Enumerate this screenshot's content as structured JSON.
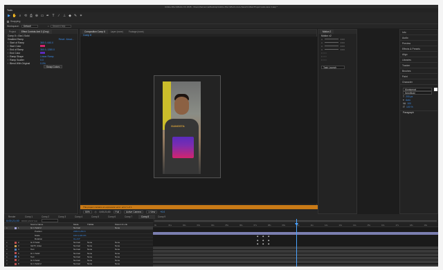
{
  "window": {
    "title": "Adobe After Effects CC 2018 - /Users/Aarvenma/Desktop/Adobe After Effects Auto-Save/Untitled Project auto-save 1.aep *"
  },
  "menubar": {
    "label": "Tools"
  },
  "toolbar": {
    "tools": [
      {
        "icon": "selection-icon",
        "glyph": "▶",
        "active": true
      },
      {
        "icon": "hand-icon",
        "glyph": "✋"
      },
      {
        "icon": "zoom-icon",
        "glyph": "⌕"
      },
      {
        "icon": "rotate-icon",
        "glyph": "⟲"
      },
      {
        "icon": "camera-icon",
        "glyph": "⎙"
      },
      {
        "icon": "pan-behind-icon",
        "glyph": "⊕"
      },
      {
        "icon": "mask-icon",
        "glyph": "▭"
      },
      {
        "icon": "pen-icon",
        "glyph": "✒"
      },
      {
        "icon": "type-icon",
        "glyph": "T"
      },
      {
        "icon": "brush-icon",
        "glyph": "∕"
      },
      {
        "icon": "stamp-icon",
        "glyph": "⊥"
      },
      {
        "icon": "eraser-icon",
        "glyph": "◆"
      },
      {
        "icon": "roto-icon",
        "glyph": "✎"
      },
      {
        "icon": "puppet-icon",
        "glyph": "✶"
      }
    ]
  },
  "snapping": {
    "label": "Snapping"
  },
  "workspace": {
    "label": "Workspace:",
    "value": "Default",
    "search_placeholder": "Search Help"
  },
  "left_panel": {
    "tabs": [
      "Project",
      "Effect Controls Amt 3 (Cmp)"
    ],
    "comp_path": "Comp 8 • Gkn1 Solid",
    "effect_name": "Gradient Ramp",
    "effect_header": {
      "reset": "Reset",
      "about": "About..."
    },
    "rows": [
      {
        "label": "Start of Ramp",
        "value": "360.0, 640.0"
      },
      {
        "label": "Start Color",
        "value": ""
      },
      {
        "label": "End of Ramp",
        "value": "360.0, 1280.0"
      },
      {
        "label": "End Color",
        "value": ""
      },
      {
        "label": "Ramp Shape",
        "value": "Linear Ramp"
      },
      {
        "label": "Ramp Scatter",
        "value": "0.0"
      },
      {
        "label": "Blend With Original",
        "value": "0.0%"
      }
    ],
    "swap_button": "Swap Colors"
  },
  "comp_panel": {
    "tabs": [
      "Composition Comp 8",
      "Layer (none)",
      "Footage (none)"
    ],
    "comp_label": "Comp 8",
    "photo_text": "GANGSTA",
    "warning": "This project contains an expression error: error 1 of 1",
    "zoom": "50%",
    "timecode": "0;00;21;00",
    "quality": "Full",
    "camera": "Active Camera",
    "views": "1 View",
    "offset": "+0.0"
  },
  "align_panel": {
    "title": "Motion 2",
    "sub": "Motion v2",
    "launch_button": "Task Launch"
  },
  "right_panel": {
    "items": [
      "Info",
      "Audio",
      "Preview",
      "Effects & Presets",
      "Align",
      "Libraries",
      "Tracker",
      "Brushes",
      "Paint",
      "Character"
    ],
    "character": {
      "font": "Montserrat",
      "style": "SemiBold",
      "size": "200 px",
      "leading": "Auto",
      "tracking": "100",
      "scale": "100 %",
      "paragraph": "Paragraph"
    }
  },
  "comp_tabs": [
    "Render Queue",
    "Comp 1",
    "Comp 2",
    "Comp 3",
    "Comp 4",
    "Comp 5",
    "Comp 6",
    "Comp 7",
    "Comp 8",
    "Comp 9"
  ],
  "timeline": {
    "timecode": "0;00;21;00",
    "fps": "00630 (29.97 fps)",
    "headers": {
      "name": "Source Name",
      "mode": "Mode",
      "trk": "TrkMat",
      "parent": "Parent & Link"
    },
    "layers": [
      {
        "num": "1",
        "name": "Gr 1 Solid 2",
        "mode": "Normal",
        "trk": "",
        "parent": "None",
        "color": "#a4a4dc",
        "selected": true
      },
      {
        "num": "",
        "name": "Position",
        "mode": "",
        "trk": "",
        "parent": "",
        "color": "",
        "value": "2382.6,250.6"
      },
      {
        "num": "",
        "name": "Scale",
        "mode": "",
        "trk": "",
        "parent": "",
        "color": "",
        "value": "100.0,100.0%"
      },
      {
        "num": "",
        "name": "Rotation",
        "mode": "",
        "trk": "",
        "parent": "",
        "color": "",
        "value": "0x+0.0°"
      },
      {
        "num": "2",
        "name": "Gr 8 Solid",
        "mode": "Normal",
        "trk": "None",
        "parent": "None",
        "color": "#c05050"
      },
      {
        "num": "3",
        "name": "GETV video",
        "mode": "Normal",
        "trk": "None",
        "parent": "None",
        "color": "#c8a050"
      },
      {
        "num": "4",
        "name": "Text",
        "mode": "Normal",
        "trk": "None",
        "parent": "None",
        "color": "#5080c0"
      },
      {
        "num": "5",
        "name": "Gr 1 Solid",
        "mode": "Normal",
        "trk": "None",
        "parent": "None",
        "color": "#c05050"
      },
      {
        "num": "6",
        "name": "Text",
        "mode": "Normal",
        "trk": "None",
        "parent": "None",
        "color": "#5080c0"
      },
      {
        "num": "7",
        "name": "Gr 9 Solid",
        "mode": "Normal",
        "trk": "None",
        "parent": "None",
        "color": "#c05050"
      },
      {
        "num": "8",
        "name": "Gr 1 Solid 2",
        "mode": "Normal",
        "trk": "None",
        "parent": "None",
        "color": "#c05050"
      }
    ],
    "ruler": [
      "0s",
      "01s",
      "02s",
      "03s",
      "04s",
      "05s",
      "06s",
      "07s",
      "08s",
      "09s",
      "10s",
      "11s",
      "12s",
      "13s",
      "14s",
      "15s",
      "16s",
      "17s",
      "18s",
      "19s"
    ]
  }
}
